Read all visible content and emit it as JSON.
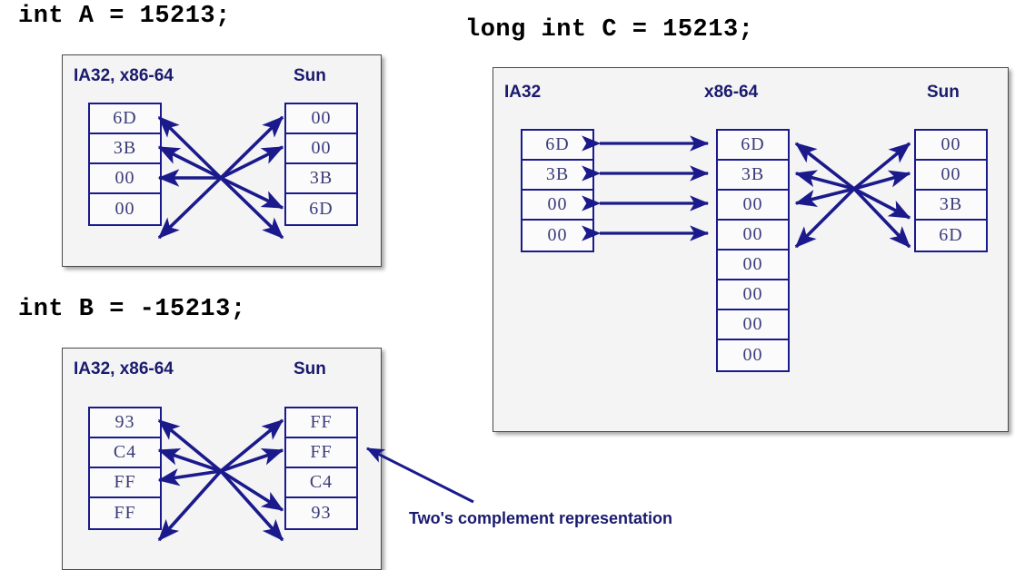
{
  "slide": {
    "title_a": "int A = 15213;",
    "title_b": "int B = -15213;",
    "title_c": "long int C = 15213;",
    "annotation": "Two's complement representation",
    "colors": {
      "box_border": "#1a1a8c",
      "panel_bg": "#f4f4f4",
      "panel_border": "#4a4a4a",
      "arrow": "#1a1a8c",
      "label_text": "#1a1a6e",
      "byte_text": "#3b3b7a",
      "caption_text": "#000000"
    }
  },
  "panel_a": {
    "caption": "int A = 15213;",
    "label_left": "IA32, x86-64",
    "label_right": "Sun",
    "left_bytes": [
      "6D",
      "3B",
      "00",
      "00"
    ],
    "right_bytes": [
      "00",
      "00",
      "3B",
      "6D"
    ]
  },
  "panel_b": {
    "caption": "int B = -15213;",
    "label_left": "IA32, x86-64",
    "label_right": "Sun",
    "left_bytes": [
      "93",
      "C4",
      "FF",
      "FF"
    ],
    "right_bytes": [
      "FF",
      "FF",
      "C4",
      "93"
    ],
    "annotation": "Two's complement representation"
  },
  "panel_c": {
    "caption": "long int C = 15213;",
    "label_left": "IA32",
    "label_mid": "x86-64",
    "label_right": "Sun",
    "left_bytes": [
      "6D",
      "3B",
      "00",
      "00"
    ],
    "mid_bytes": [
      "6D",
      "3B",
      "00",
      "00",
      "00",
      "00",
      "00",
      "00"
    ],
    "right_bytes": [
      "00",
      "00",
      "3B",
      "6D"
    ]
  }
}
